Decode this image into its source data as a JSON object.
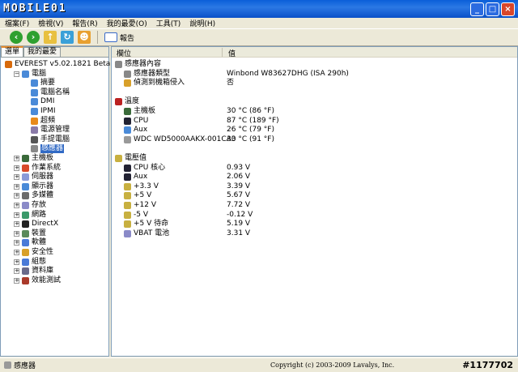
{
  "title": {
    "logo": "MOBILE01"
  },
  "menu": [
    "檔案(F)",
    "檢視(V)",
    "報告(R)",
    "我的最愛(O)",
    "工具(T)",
    "說明(H)"
  ],
  "toolbar": {
    "report_label": "報告"
  },
  "left": {
    "tabs": [
      "選單",
      "我的最愛"
    ],
    "tree": [
      {
        "label": "EVEREST v5.02.1821 Beta",
        "level": 0,
        "icon": "info-icon",
        "color": "#d86a0a"
      },
      {
        "label": "電腦",
        "level": 1,
        "icon": "computer-icon",
        "color": "#4a8ad8",
        "exp": "−"
      },
      {
        "label": "摘要",
        "level": 2,
        "icon": "computer-icon",
        "color": "#4a8ad8"
      },
      {
        "label": "電腦名稱",
        "level": 2,
        "icon": "computer-icon",
        "color": "#4a8ad8"
      },
      {
        "label": "DMI",
        "level": 2,
        "icon": "computer-icon",
        "color": "#4a8ad8"
      },
      {
        "label": "IPMI",
        "level": 2,
        "icon": "computer-icon",
        "color": "#4a8ad8"
      },
      {
        "label": "超頻",
        "level": 2,
        "icon": "fire-icon",
        "color": "#e88a1a"
      },
      {
        "label": "電源管理",
        "level": 2,
        "icon": "power-icon",
        "color": "#8a7aa8"
      },
      {
        "label": "手提電腦",
        "level": 2,
        "icon": "laptop-icon",
        "color": "#555"
      },
      {
        "label": "感應器",
        "level": 2,
        "icon": "sensor-icon",
        "color": "#888",
        "selected": true
      },
      {
        "label": "主機板",
        "level": 1,
        "icon": "motherboard-icon",
        "color": "#3a6a3a",
        "exp": "+"
      },
      {
        "label": "作業系統",
        "level": 1,
        "icon": "windows-icon",
        "color": "#d84a2a",
        "exp": "+"
      },
      {
        "label": "伺服器",
        "level": 1,
        "icon": "server-icon",
        "color": "#8a9ad8",
        "exp": "+"
      },
      {
        "label": "顯示器",
        "level": 1,
        "icon": "monitor-icon",
        "color": "#4a8ad8",
        "exp": "+"
      },
      {
        "label": "多媒體",
        "level": 1,
        "icon": "multimedia-icon",
        "color": "#6a6a6a",
        "exp": "+"
      },
      {
        "label": "存放",
        "level": 1,
        "icon": "storage-icon",
        "color": "#8a8ac8",
        "exp": "+"
      },
      {
        "label": "網路",
        "level": 1,
        "icon": "network-icon",
        "color": "#3a9a6a",
        "exp": "+"
      },
      {
        "label": "DirectX",
        "level": 1,
        "icon": "directx-icon",
        "color": "#222",
        "exp": "+"
      },
      {
        "label": "裝置",
        "level": 1,
        "icon": "device-icon",
        "color": "#5a8a5a",
        "exp": "+"
      },
      {
        "label": "軟體",
        "level": 1,
        "icon": "software-icon",
        "color": "#4a7ad8",
        "exp": "+"
      },
      {
        "label": "安全性",
        "level": 1,
        "icon": "security-icon",
        "color": "#d8a02a",
        "exp": "+"
      },
      {
        "label": "組態",
        "level": 1,
        "icon": "config-icon",
        "color": "#4a7ad8",
        "exp": "+"
      },
      {
        "label": "資料庫",
        "level": 1,
        "icon": "database-icon",
        "color": "#6a6a8a",
        "exp": "+"
      },
      {
        "label": "效能測試",
        "level": 1,
        "icon": "benchmark-icon",
        "color": "#aa3a2a",
        "exp": "+"
      }
    ]
  },
  "right": {
    "headers": [
      "欄位",
      "值"
    ],
    "rows": [
      {
        "field": "感應器內容",
        "value": "",
        "level": 0,
        "icon": "sensor-icon",
        "color": "#888"
      },
      {
        "field": "感應器類型",
        "value": "Winbond W83627DHG  (ISA 290h)",
        "level": 1,
        "icon": "sensor-icon",
        "color": "#888"
      },
      {
        "field": "偵測到機箱侵入",
        "value": "否",
        "level": 1,
        "icon": "lock-icon",
        "color": "#d8a02a"
      },
      {
        "field": "",
        "value": "",
        "level": 0
      },
      {
        "field": "溫度",
        "value": "",
        "level": 0,
        "icon": "thermometer-icon",
        "color": "#b22"
      },
      {
        "field": "主機板",
        "value": "30 °C  (86 °F)",
        "level": 1,
        "icon": "motherboard-icon",
        "color": "#3a6a3a"
      },
      {
        "field": "CPU",
        "value": "87 °C  (189 °F)",
        "level": 1,
        "icon": "cpu-icon",
        "color": "#223"
      },
      {
        "field": "Aux",
        "value": "26 °C  (79 °F)",
        "level": 1,
        "icon": "computer-icon",
        "color": "#4a8ad8"
      },
      {
        "field": "WDC WD5000AAKX-001CA0",
        "value": "33 °C  (91 °F)",
        "level": 1,
        "icon": "hdd-icon",
        "color": "#999"
      },
      {
        "field": "",
        "value": "",
        "level": 0
      },
      {
        "field": "電壓值",
        "value": "",
        "level": 0,
        "icon": "voltage-icon",
        "color": "#c8b040"
      },
      {
        "field": "CPU 核心",
        "value": "0.93 V",
        "level": 1,
        "icon": "cpu-icon",
        "color": "#223"
      },
      {
        "field": "Aux",
        "value": "2.06 V",
        "level": 1,
        "icon": "cpu-icon",
        "color": "#223"
      },
      {
        "field": "+3.3 V",
        "value": "3.39 V",
        "level": 1,
        "icon": "voltage-icon",
        "color": "#c8b040"
      },
      {
        "field": "+5 V",
        "value": "5.67 V",
        "level": 1,
        "icon": "voltage-icon",
        "color": "#c8b040"
      },
      {
        "field": "+12 V",
        "value": "7.72 V",
        "level": 1,
        "icon": "voltage-icon",
        "color": "#c8b040"
      },
      {
        "field": "-5 V",
        "value": "-0.12 V",
        "level": 1,
        "icon": "voltage-icon",
        "color": "#c8b040"
      },
      {
        "field": "+5 V 待命",
        "value": "5.19 V",
        "level": 1,
        "icon": "voltage-icon",
        "color": "#c8b040"
      },
      {
        "field": "VBAT 電池",
        "value": "3.31 V",
        "level": 1,
        "icon": "battery-icon",
        "color": "#8a8ac8"
      }
    ]
  },
  "status": {
    "left": "感應器",
    "copyright": "Copyright (c) 2003-2009 Lavalys, Inc.",
    "watermark": "#1177702"
  }
}
